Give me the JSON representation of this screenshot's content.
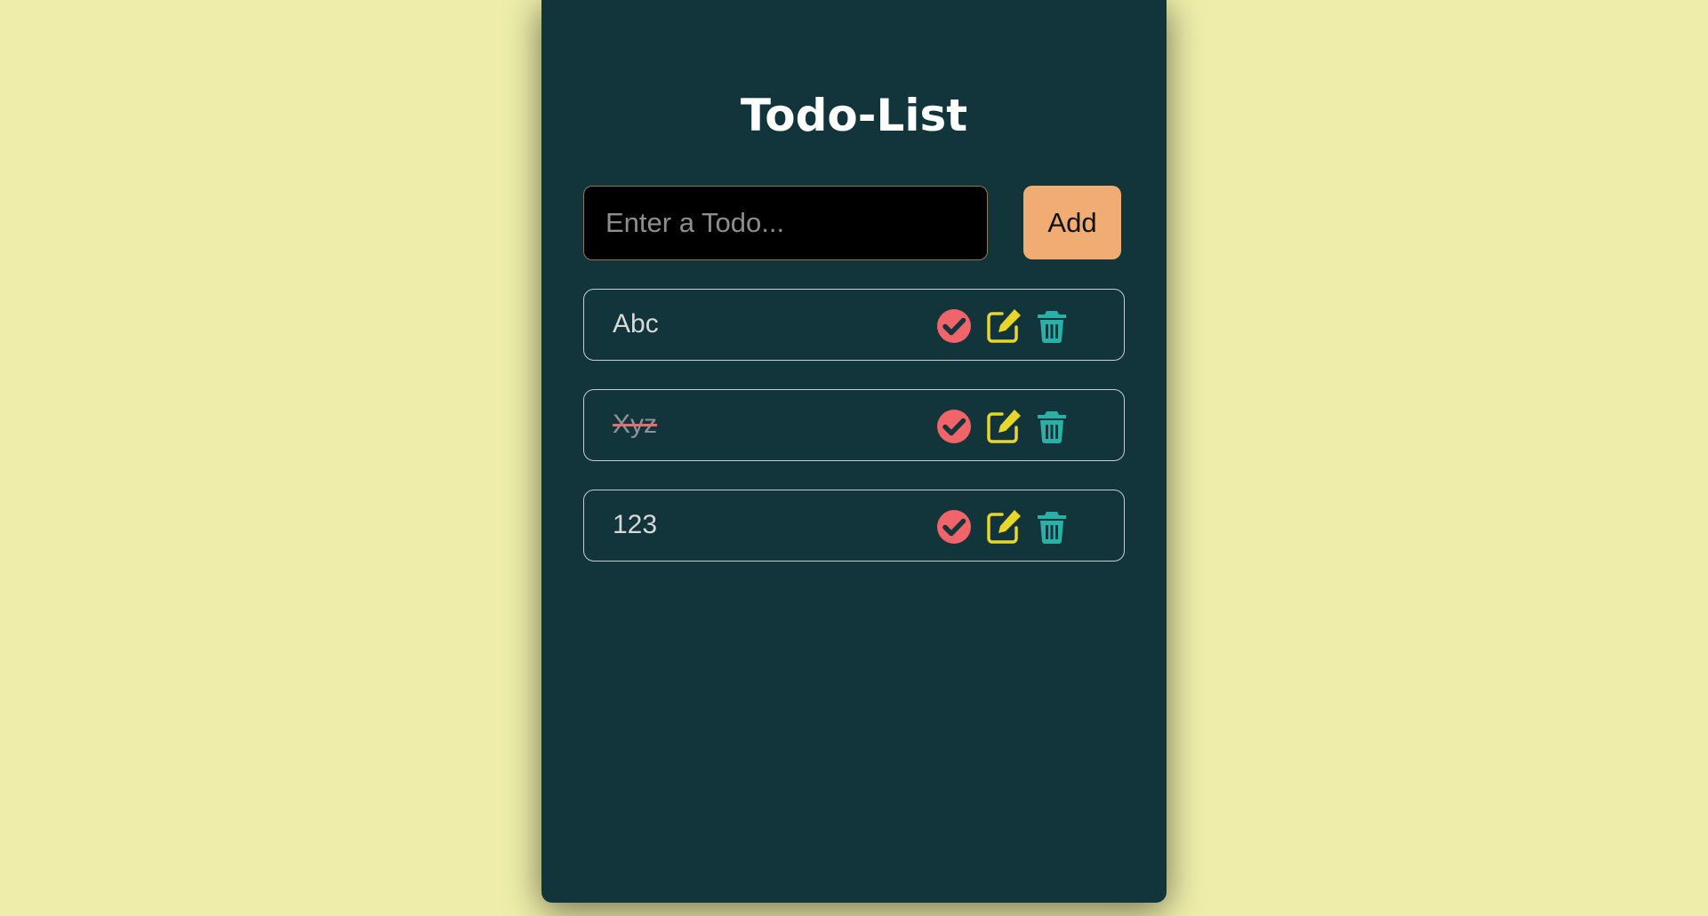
{
  "app": {
    "title": "Todo-List"
  },
  "form": {
    "input_value": "",
    "input_placeholder": "Enter a Todo...",
    "add_label": "Add"
  },
  "todos": [
    {
      "text": "Abc",
      "completed": false
    },
    {
      "text": "Xyz",
      "completed": true
    },
    {
      "text": "123",
      "completed": false
    }
  ],
  "icons": {
    "complete": "check-circle-icon",
    "edit": "edit-icon",
    "delete": "trash-icon"
  },
  "colors": {
    "page_background": "#eeeeaa",
    "card_background": "#12343b",
    "add_button": "#f0ac73",
    "complete_icon": "#f0646a",
    "edit_icon": "#e8d62a",
    "delete_icon": "#2bb0a8"
  }
}
